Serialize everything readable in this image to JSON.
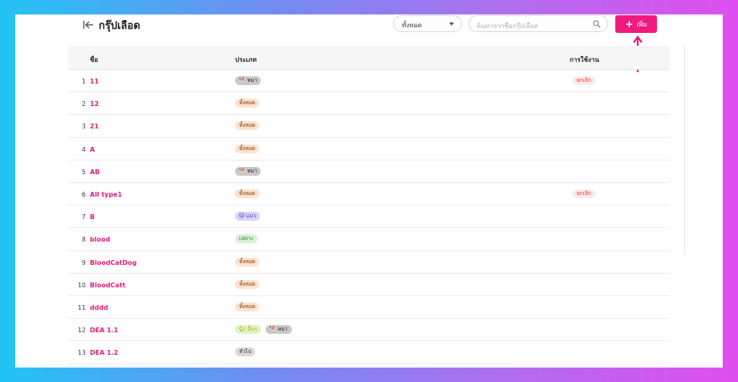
{
  "header": {
    "title": "กรุ๊ปเลือด",
    "filter": {
      "selected": "ทั้งหมด"
    },
    "search": {
      "placeholder": "ค้นหาจากชื่อกรุ๊ปเลือด"
    },
    "add_label": "เพิ่ม"
  },
  "table": {
    "columns": {
      "name": "ชื่อ",
      "type": "ประเภท",
      "usage": "การใช้งาน"
    },
    "rows": [
      {
        "index": "1",
        "name": "11",
        "tags": [
          {
            "label": "🐕 หมา",
            "kind": "dog"
          }
        ],
        "usage": "ยกเลิก"
      },
      {
        "index": "2",
        "name": "12",
        "tags": [
          {
            "label": "ทั้งหมด",
            "kind": "all"
          }
        ],
        "usage": ""
      },
      {
        "index": "3",
        "name": "21",
        "tags": [
          {
            "label": "ทั้งหมด",
            "kind": "all"
          }
        ],
        "usage": ""
      },
      {
        "index": "4",
        "name": "A",
        "tags": [
          {
            "label": "ทั้งหมด",
            "kind": "all"
          }
        ],
        "usage": ""
      },
      {
        "index": "5",
        "name": "AB",
        "tags": [
          {
            "label": "🐕 หมา",
            "kind": "dog"
          }
        ],
        "usage": ""
      },
      {
        "index": "6",
        "name": "All type1",
        "tags": [
          {
            "label": "ทั้งหมด",
            "kind": "all"
          }
        ],
        "usage": "ยกเลิก"
      },
      {
        "index": "7",
        "name": "B",
        "tags": [
          {
            "label": "🐱 แมว",
            "kind": "cat"
          }
        ],
        "usage": ""
      },
      {
        "index": "8",
        "name": "blood",
        "tags": [
          {
            "label": "เฉพาะ",
            "kind": "spec"
          }
        ],
        "usage": ""
      },
      {
        "index": "9",
        "name": "BloodCatDog",
        "tags": [
          {
            "label": "ทั้งหมด",
            "kind": "all"
          }
        ],
        "usage": ""
      },
      {
        "index": "10",
        "name": "BloodCatt",
        "tags": [
          {
            "label": "ทั้งหมด",
            "kind": "all"
          }
        ],
        "usage": ""
      },
      {
        "index": "11",
        "name": "dddd",
        "tags": [
          {
            "label": "ทั้งหมด",
            "kind": "all"
          }
        ],
        "usage": ""
      },
      {
        "index": "12",
        "name": "DEA 1.1",
        "tags": [
          {
            "label": "🐿 อื่นๆ",
            "kind": "other"
          },
          {
            "label": "🐕 หมา",
            "kind": "dog"
          }
        ],
        "usage": ""
      },
      {
        "index": "13",
        "name": "DEA 1.2",
        "tags": [
          {
            "label": "ทั่วไป",
            "kind": "gen"
          }
        ],
        "usage": ""
      }
    ]
  },
  "colors": {
    "accent": "#f0197d",
    "cancel": "#e03131"
  },
  "icons": {
    "collapse": "collapse-left-icon",
    "search": "search-icon",
    "add": "plus-icon",
    "arrow": "arrow-up-icon"
  }
}
